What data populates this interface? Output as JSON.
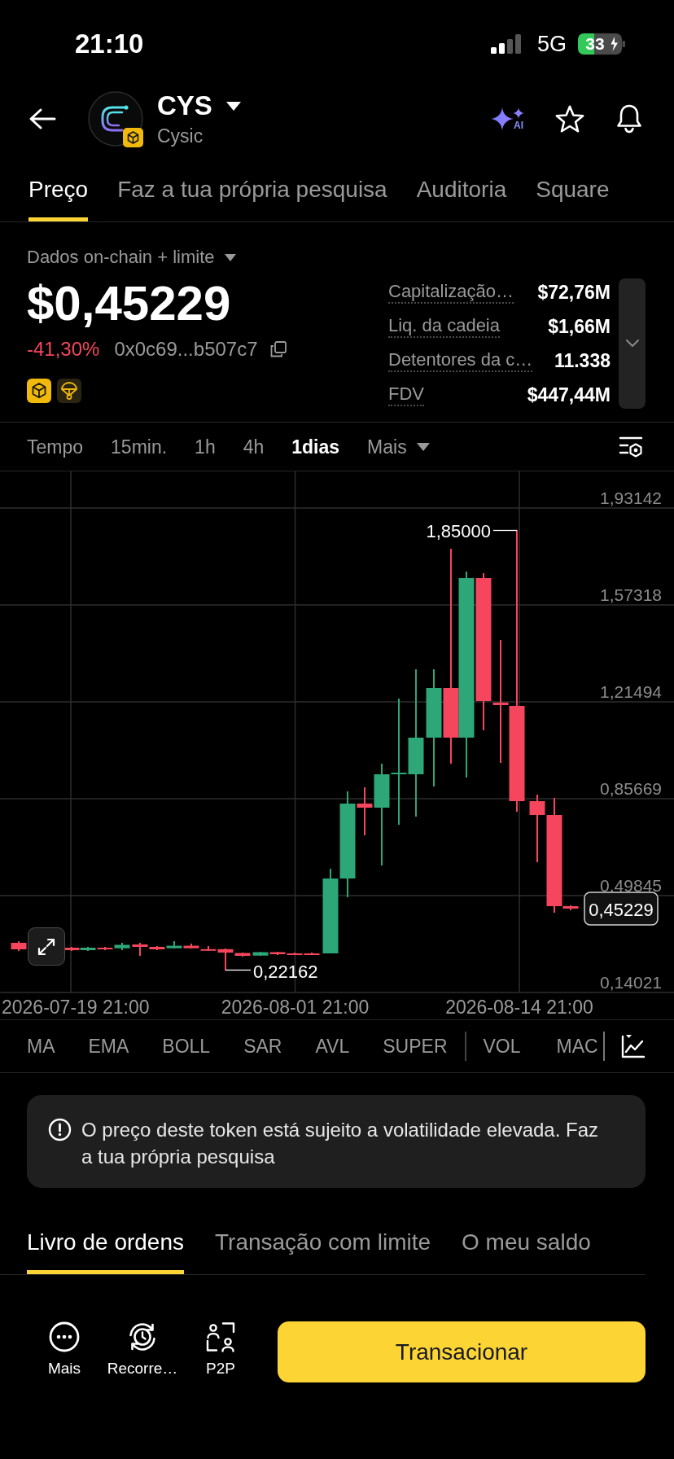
{
  "status_bar": {
    "time": "21:10",
    "network": "5G",
    "battery": "33"
  },
  "header": {
    "symbol": "CYS",
    "name": "Cysic",
    "ai_label": "AI"
  },
  "tabs": [
    {
      "label": "Preço",
      "selected": true
    },
    {
      "label": "Faz a tua própria pesquisa",
      "selected": false
    },
    {
      "label": "Auditoria",
      "selected": false
    },
    {
      "label": "Square",
      "selected": false
    }
  ],
  "overview": {
    "source": "Dados on-chain + limite",
    "price": "$0,45229",
    "change": "-41,30%",
    "negative": true,
    "address": "0x0c69...b507c7"
  },
  "stats": {
    "expanded": false,
    "rows": [
      {
        "label": "Capitalização…",
        "value": "$72,76M"
      },
      {
        "label": "Liq. da cadeia",
        "value": "$1,66M"
      },
      {
        "label": "Detentores da c…",
        "value": "11.338"
      },
      {
        "label": "FDV",
        "value": "$447,44M"
      }
    ]
  },
  "interval_caption": "Tempo",
  "intervals": [
    {
      "label": "15min.",
      "kind": "option",
      "selected": false
    },
    {
      "label": "1h",
      "kind": "option",
      "selected": false
    },
    {
      "label": "4h",
      "kind": "option",
      "selected": false
    },
    {
      "label": "1dias",
      "kind": "option",
      "selected": true
    },
    {
      "label": "Mais",
      "kind": "menu",
      "selected": false
    }
  ],
  "chart": {
    "price_ticks": [
      "1,93142",
      "1,57318",
      "1,21494",
      "0,85669",
      "0,49845",
      "0,14021"
    ],
    "date_ticks": [
      "2026-07-19 21:00",
      "2026-08-01 21:00",
      "2026-08-14 21:00"
    ],
    "high_label": "1,85000",
    "low_label": "0,22162",
    "last_price": "0,45229"
  },
  "indicators": {
    "main": [
      {
        "label": "MA",
        "selected": false
      },
      {
        "label": "EMA",
        "selected": false
      },
      {
        "label": "BOLL",
        "selected": false
      },
      {
        "label": "SAR",
        "selected": false
      },
      {
        "label": "AVL",
        "selected": false
      },
      {
        "label": "SUPER",
        "selected": false
      }
    ],
    "sub": [
      {
        "label": "VOL",
        "selected": false
      },
      {
        "label": "MAC",
        "selected": false
      }
    ]
  },
  "notice": "O preço deste token está sujeito a volatilidade elevada. Faz a tua própria pesquisa",
  "section_tabs": [
    {
      "label": "Livro de ordens",
      "selected": true
    },
    {
      "label": "Transação com limite",
      "selected": false
    },
    {
      "label": "O meu saldo",
      "selected": false
    }
  ],
  "bottom_bar": {
    "actions": [
      {
        "label": "Mais",
        "kind": "more"
      },
      {
        "label": "Recorre…",
        "kind": "recurring"
      },
      {
        "label": "P2P",
        "kind": "p2p"
      }
    ],
    "primary_button": "Transacionar"
  }
}
